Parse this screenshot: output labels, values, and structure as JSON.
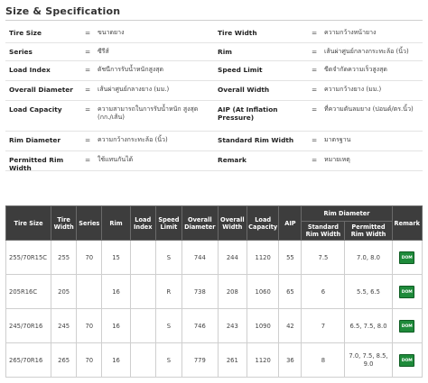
{
  "section": {
    "title": "Size & Specification"
  },
  "specs": [
    {
      "left": {
        "label": "Tire Size",
        "value": "ขนาดยาง"
      },
      "right": {
        "label": "Tire Width",
        "value": "ความกว้างหน้ายาง"
      }
    },
    {
      "left": {
        "label": "Series",
        "value": "ซีรีส์"
      },
      "right": {
        "label": "Rim",
        "value": "เส้นผ่าศูนย์กลางกระทะล้อ (นิ้ว)"
      }
    },
    {
      "left": {
        "label": "Load Index",
        "value": "ดัชนีการรับน้ำหนักสูงสุด"
      },
      "right": {
        "label": "Speed Limit",
        "value": "ขีดจำกัดความเร็วสูงสุด"
      }
    },
    {
      "left": {
        "label": "Overall Diameter",
        "value": "เส้นผ่าศูนย์กลางยาง (มม.)"
      },
      "right": {
        "label": "Overall Width",
        "value": "ความกว้างยาง (มม.)"
      }
    },
    {
      "left": {
        "label": "Load Capacity",
        "value": "ความสามารถในการรับน้ำหนัก สูงสุด (กก./เส้น)"
      },
      "right": {
        "label": "AIP (At Inflation Pressure)",
        "value": "ที่ความดันลมยาง (ปอนด์/ตร.นิ้ว)"
      }
    },
    {
      "left": {
        "label": "Rim Diameter",
        "value": "ความกว้างกระทะล้อ (นิ้ว)"
      },
      "right": {
        "label": "Standard Rim Width",
        "value": "มาตรฐาน"
      }
    },
    {
      "left": {
        "label": "Permitted Rim Width",
        "value": "ใช้แทนกันได้"
      },
      "right": {
        "label": "Remark",
        "value": "หมายเหตุ"
      }
    }
  ],
  "table": {
    "headers": {
      "tire_size": "Tire Size",
      "tire_width": "Tire Width",
      "series": "Series",
      "rim": "Rim",
      "load_index": "Load Index",
      "speed_limit": "Speed Limit",
      "overall_diameter": "Overall Diameter",
      "overall_width": "Overall Width",
      "load_capacity": "Load Capacity",
      "aip": "AIP",
      "rim_diameter": "Rim Diameter",
      "standard_rim_width": "Standard Rim Width",
      "permitted_rim_width": "Permitted Rim Width",
      "remark": "Remark"
    },
    "rows": [
      {
        "size": "255/70R15C",
        "width": "255",
        "series": "70",
        "rim": "15",
        "load_index": "",
        "speed": "S",
        "diameter": "744",
        "overall_width": "244",
        "capacity": "1120",
        "aip": "55",
        "std_rim": "7.5",
        "perm_rim": "7.0, 8.0",
        "remark": "DOM"
      },
      {
        "size": "205R16C",
        "width": "205",
        "series": "",
        "rim": "16",
        "load_index": "",
        "speed": "R",
        "diameter": "738",
        "overall_width": "208",
        "capacity": "1060",
        "aip": "65",
        "std_rim": "6",
        "perm_rim": "5.5, 6.5",
        "remark": "DOM"
      },
      {
        "size": "245/70R16",
        "width": "245",
        "series": "70",
        "rim": "16",
        "load_index": "",
        "speed": "S",
        "diameter": "746",
        "overall_width": "243",
        "capacity": "1090",
        "aip": "42",
        "std_rim": "7",
        "perm_rim": "6.5, 7.5, 8.0",
        "remark": "DOM"
      },
      {
        "size": "265/70R16",
        "width": "265",
        "series": "70",
        "rim": "16",
        "load_index": "",
        "speed": "S",
        "diameter": "779",
        "overall_width": "261",
        "capacity": "1120",
        "aip": "36",
        "std_rim": "8",
        "perm_rim": "7.0, 7.5, 8.5, 9.0",
        "remark": "DOM"
      }
    ]
  }
}
